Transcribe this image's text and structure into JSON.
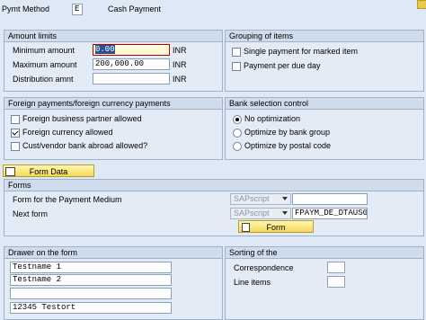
{
  "top": {
    "pymt_method_label": "Pymt Method",
    "pymt_method_value": "E",
    "pymt_method_desc": "Cash Payment"
  },
  "amount_limits": {
    "title": "Amount limits",
    "min_label": "Minimum amount",
    "min_value": "0.00",
    "min_unit": "INR",
    "max_label": "Maximum amount",
    "max_value": "200,000.00",
    "max_unit": "INR",
    "dist_label": "Distribution amnt",
    "dist_value": "",
    "dist_unit": "INR"
  },
  "grouping": {
    "title": "Grouping of items",
    "opt1": "Single payment for marked item",
    "opt1_checked": false,
    "opt2": "Payment per due day",
    "opt2_checked": false
  },
  "foreign": {
    "title": "Foreign payments/foreign currency payments",
    "opt1": "Foreign business partner allowed",
    "opt1_checked": false,
    "opt2": "Foreign currency allowed",
    "opt2_checked": true,
    "opt3": "Cust/vendor bank abroad allowed?",
    "opt3_checked": false
  },
  "bank_selection": {
    "title": "Bank selection control",
    "opt1": "No optimization",
    "opt2": "Optimize by bank group",
    "opt3": "Optimize by postal code",
    "selected": "No optimization"
  },
  "form_data_button": "Form Data",
  "forms": {
    "title": "Forms",
    "medium_label": "Form for the Payment Medium",
    "medium_type": "SAPscript",
    "medium_value": "",
    "next_label": "Next form",
    "next_type": "SAPscript",
    "next_value": "FPAYM_DE_DTAUS0",
    "form_button": "Form"
  },
  "drawer": {
    "title": "Drawer on the form",
    "lines": [
      "Testname 1",
      "Testname 2",
      "",
      "12345 Testort"
    ]
  },
  "sorting": {
    "title": "Sorting of the",
    "row1": "Correspondence",
    "row2": "Line items"
  }
}
